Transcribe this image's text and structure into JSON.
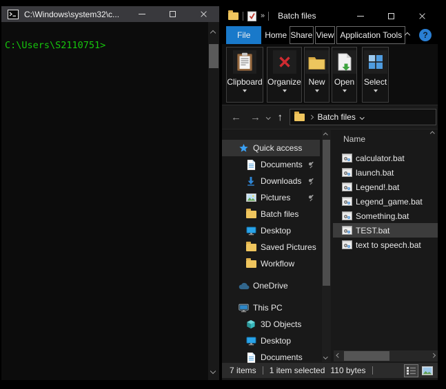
{
  "colors": {
    "accent_blue": "#1979ca",
    "cmd_green": "#16c60c",
    "selection_gray": "#3c3c3c",
    "folder_yellow": "#efc55e"
  },
  "cmd": {
    "title": "C:\\Windows\\system32\\c...",
    "prompt_line": "C:\\Users\\S2110751>",
    "icons": [
      "cmd-icon",
      "scroll-up-icon",
      "scroll-down-icon"
    ]
  },
  "explorer": {
    "title": "Batch files",
    "qat": {
      "icons": [
        "folder-icon",
        "properties-check-icon"
      ],
      "expand_glyph": "»"
    },
    "tabs": [
      {
        "label": "File"
      },
      {
        "label": "Home"
      },
      {
        "label": "Share"
      },
      {
        "label": "View"
      },
      {
        "label": "Application Tools"
      }
    ],
    "help_glyph": "?",
    "ribbon_groups": [
      {
        "label": "Clipboard",
        "icon": "clipboard-icon"
      },
      {
        "label": "Organize",
        "icon": "delete-x-icon"
      },
      {
        "label": "New",
        "icon": "new-folder-icon"
      },
      {
        "label": "Open",
        "icon": "open-file-icon"
      },
      {
        "label": "Select",
        "icon": "select-grid-icon"
      }
    ],
    "address_bar": {
      "back_arrow": "←",
      "forward_arrow": "→",
      "up_arrow": "↑",
      "location": "Batch files",
      "icon": "folder-icon"
    },
    "nav_pane": {
      "items": [
        {
          "label": "Quick access",
          "icon": "star-icon",
          "selected": true,
          "level": 0
        },
        {
          "label": "Documents",
          "icon": "document-icon",
          "pinned": true,
          "level": 1
        },
        {
          "label": "Downloads",
          "icon": "download-arrow-icon",
          "pinned": true,
          "level": 1
        },
        {
          "label": "Pictures",
          "icon": "picture-icon",
          "pinned": true,
          "level": 1
        },
        {
          "label": "Batch files",
          "icon": "folder-icon",
          "level": 1
        },
        {
          "label": "Desktop",
          "icon": "desktop-icon",
          "level": 1
        },
        {
          "label": "Saved Pictures",
          "icon": "folder-icon",
          "level": 1
        },
        {
          "label": "Workflow",
          "icon": "folder-icon",
          "level": 1
        },
        {
          "label": "OneDrive",
          "icon": "onedrive-cloud-icon",
          "level": 0
        },
        {
          "label": "This PC",
          "icon": "computer-icon",
          "level": 0
        },
        {
          "label": "3D Objects",
          "icon": "cube-icon",
          "level": 1
        },
        {
          "label": "Desktop",
          "icon": "desktop-icon",
          "level": 1
        },
        {
          "label": "Documents",
          "icon": "document-icon",
          "level": 1
        }
      ]
    },
    "file_list": {
      "column_header": "Name",
      "items": [
        {
          "name": "calculator.bat",
          "icon": "batch-file-icon"
        },
        {
          "name": "launch.bat",
          "icon": "batch-file-icon"
        },
        {
          "name": "Legend!.bat",
          "icon": "batch-file-icon"
        },
        {
          "name": "Legend_game.bat",
          "icon": "batch-file-icon"
        },
        {
          "name": "Something.bat",
          "icon": "batch-file-icon"
        },
        {
          "name": "TEST.bat",
          "icon": "batch-file-icon",
          "selected": true
        },
        {
          "name": "text to speech.bat",
          "icon": "batch-file-icon"
        }
      ]
    },
    "status_bar": {
      "items_count": "7 items",
      "selection": "1 item selected",
      "size": "110 bytes",
      "view_buttons": [
        "details-view-icon",
        "thumbnail-view-icon"
      ]
    }
  }
}
